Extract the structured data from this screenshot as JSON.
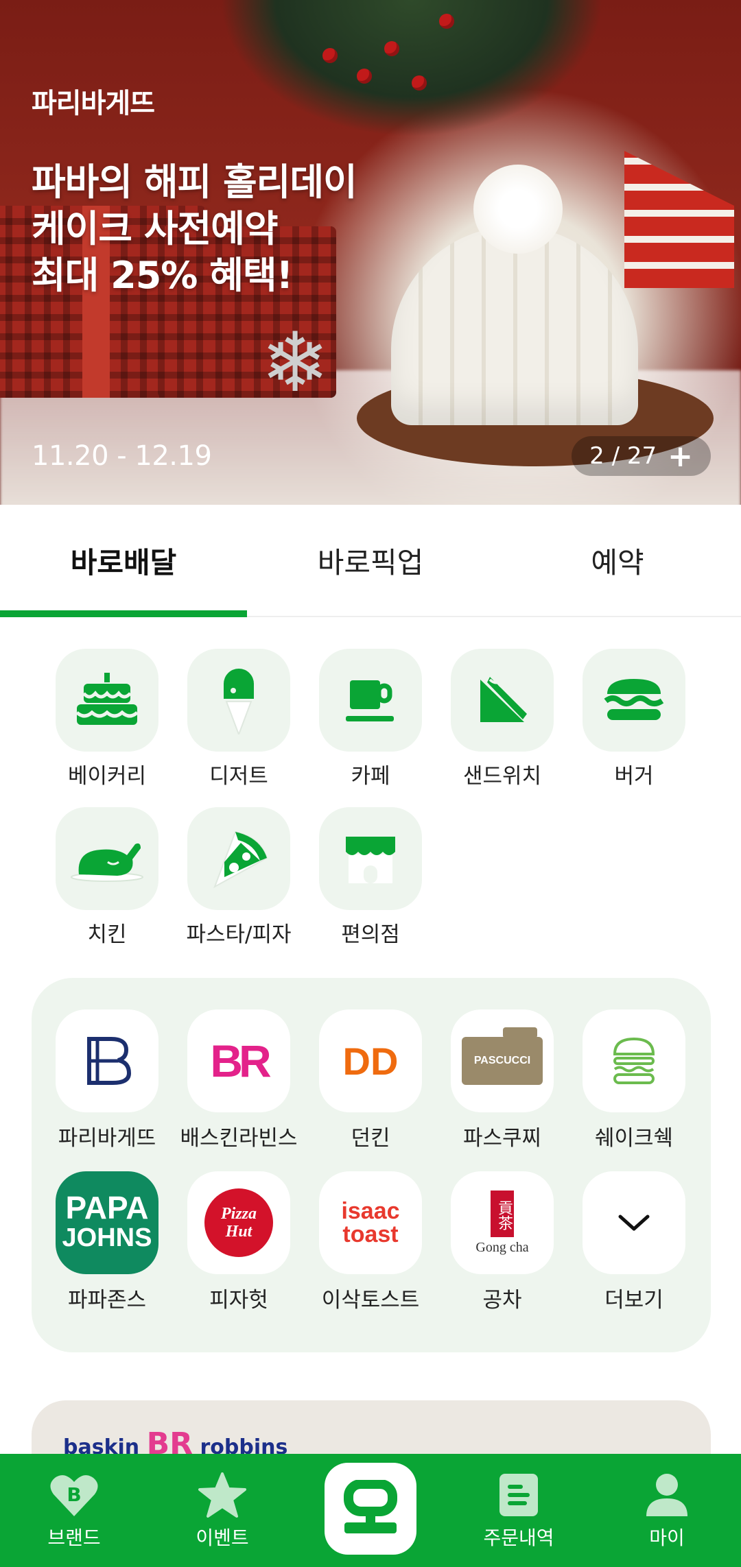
{
  "banner": {
    "brand": "파리바게뜨",
    "headline_lines": [
      "파바의 해피 홀리데이",
      "케이크 사전예약",
      "최대 25% 혜택!"
    ],
    "dates": "11.20 - 12.19",
    "counter": "2 / 27",
    "plus_label": "+"
  },
  "tabs": [
    {
      "label": "바로배달",
      "active": true
    },
    {
      "label": "바로픽업",
      "active": false
    },
    {
      "label": "예약",
      "active": false
    }
  ],
  "categories": [
    {
      "label": "베이커리",
      "icon": "cake-icon"
    },
    {
      "label": "디저트",
      "icon": "ice-cream-icon"
    },
    {
      "label": "카페",
      "icon": "coffee-cup-icon"
    },
    {
      "label": "샌드위치",
      "icon": "sandwich-icon"
    },
    {
      "label": "버거",
      "icon": "burger-icon"
    },
    {
      "label": "치킨",
      "icon": "roast-chicken-icon"
    },
    {
      "label": "파스타/피자",
      "icon": "pizza-slice-icon"
    },
    {
      "label": "편의점",
      "icon": "store-icon"
    }
  ],
  "brands": [
    {
      "label": "파리바게뜨",
      "logo_text": "B"
    },
    {
      "label": "배스킨라빈스",
      "logo_text": "BR"
    },
    {
      "label": "던킨",
      "logo_text": "DD"
    },
    {
      "label": "파스쿠찌",
      "logo_text": "PASCUCCI"
    },
    {
      "label": "쉐이크쉑",
      "logo_text": ""
    },
    {
      "label": "파파존스",
      "logo_text_1": "PAPA",
      "logo_text_2": "JOHNS"
    },
    {
      "label": "피자헛",
      "logo_text_1": "Pizza",
      "logo_text_2": "Hut"
    },
    {
      "label": "이삭토스트",
      "logo_text_1": "isaac",
      "logo_text_2": "toast"
    },
    {
      "label": "공차",
      "logo_text": "Gong cha",
      "seal_text": "貢茶"
    },
    {
      "label": "더보기",
      "icon": "chevron-down-icon"
    }
  ],
  "teaser": {
    "logo_left": "baskin",
    "logo_mid": "BR",
    "logo_right": "robbins"
  },
  "bottom_nav": [
    {
      "label": "브랜드",
      "icon": "heart-b-icon"
    },
    {
      "label": "이벤트",
      "icon": "star-icon"
    },
    {
      "label": "",
      "icon": "home-logo-icon"
    },
    {
      "label": "주문내역",
      "icon": "receipt-icon"
    },
    {
      "label": "마이",
      "icon": "person-icon"
    }
  ],
  "colors": {
    "accent": "#0aa535",
    "tile_bg": "#eef5ee",
    "icon_green": "#0aa535"
  }
}
